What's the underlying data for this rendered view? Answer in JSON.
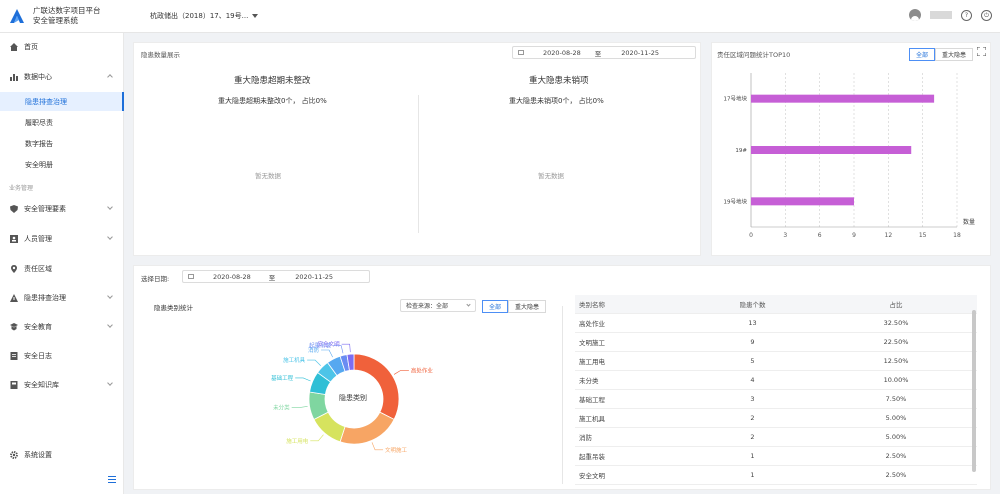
{
  "header": {
    "app_title_line1": "广联达数字项目平台",
    "app_title_line2": "安全管理系统",
    "project": "杭政储出（2018）17、19号..."
  },
  "sidebar": {
    "home": "首页",
    "data_center": "数据中心",
    "sub_items": [
      "隐患排查治理",
      "履职尽责",
      "数字报告",
      "安全明册"
    ],
    "group_label": "业务管理",
    "items": [
      "安全管理要素",
      "人员管理",
      "责任区域",
      "隐患排查治理",
      "安全教育",
      "安全日志",
      "安全知识库"
    ],
    "settings": "系统设置"
  },
  "hazard_card": {
    "title": "隐患数量展示",
    "date_from": "2020-08-28",
    "date_to_sep": "至",
    "date_to": "2020-11-25",
    "left_title": "重大隐患超期未整改",
    "left_sub": "重大隐患超期未整改0个，  占比0%",
    "right_title": "重大隐患未销项",
    "right_sub": "重大隐患未销项0个，  占比0%",
    "no_data": "暂无数据"
  },
  "top10": {
    "title": "责任区域问题统计TOP10",
    "seg_all": "全部",
    "seg_major": "重大隐患",
    "unit": "数量"
  },
  "filter": {
    "label": "选择日期:",
    "date_from": "2020-08-28",
    "sep": "至",
    "date_to": "2020-11-25"
  },
  "category": {
    "title": "隐患类别统计",
    "source_select": "检查来源：全部",
    "seg_all": "全部",
    "seg_major": "重大隐患",
    "center_label": "隐患类别"
  },
  "table": {
    "headers": [
      "类别名称",
      "隐患个数",
      "占比"
    ],
    "rows": [
      {
        "name": "高处作业",
        "count": "13",
        "pct": "32.50%"
      },
      {
        "name": "文明施工",
        "count": "9",
        "pct": "22.50%"
      },
      {
        "name": "施工用电",
        "count": "5",
        "pct": "12.50%"
      },
      {
        "name": "未分类",
        "count": "4",
        "pct": "10.00%"
      },
      {
        "name": "基础工程",
        "count": "3",
        "pct": "7.50%"
      },
      {
        "name": "施工机具",
        "count": "2",
        "pct": "5.00%"
      },
      {
        "name": "消防",
        "count": "2",
        "pct": "5.00%"
      },
      {
        "name": "起重吊装",
        "count": "1",
        "pct": "2.50%"
      },
      {
        "name": "安全文明",
        "count": "1",
        "pct": "2.50%"
      }
    ]
  },
  "chart_data": [
    {
      "type": "bar",
      "orientation": "horizontal",
      "title": "责任区域问题统计TOP10",
      "categories": [
        "17号地块",
        "19#",
        "19号地块"
      ],
      "values": [
        16,
        14,
        9
      ],
      "xlim": [
        0,
        18
      ],
      "xticks": [
        "0",
        "3",
        "6",
        "9",
        "12",
        "15",
        "18"
      ],
      "xlabel": "数量",
      "color": "#c65fd6"
    },
    {
      "type": "pie",
      "title": "隐患类别统计",
      "labels": [
        "高处作业",
        "文明施工",
        "施工用电",
        "未分类",
        "基础工程",
        "施工机具",
        "消防",
        "起重吊装",
        "安全文明"
      ],
      "values": [
        13,
        9,
        5,
        4,
        3,
        2,
        2,
        1,
        1
      ],
      "colors": [
        "#f0613b",
        "#f7a564",
        "#d6e35e",
        "#7fd6a0",
        "#2fbfd6",
        "#4dc4e8",
        "#56a8f0",
        "#6a8cf2",
        "#7c6df2"
      ]
    }
  ]
}
